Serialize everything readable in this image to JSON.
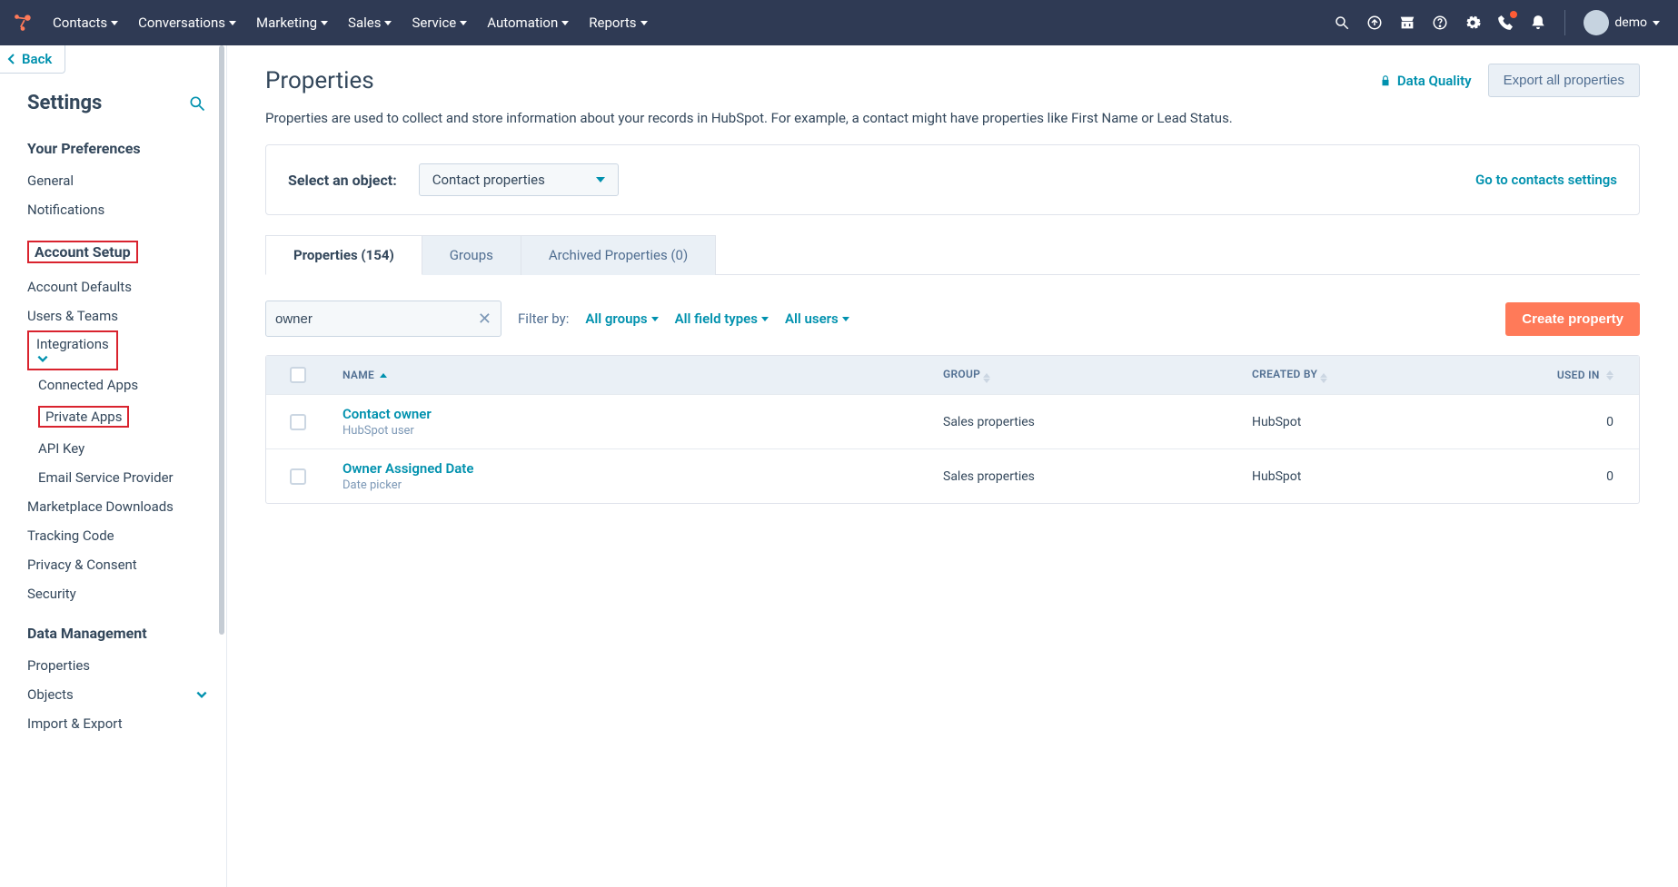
{
  "topnav": {
    "menu": [
      "Contacts",
      "Conversations",
      "Marketing",
      "Sales",
      "Service",
      "Automation",
      "Reports"
    ],
    "user_label": "demo"
  },
  "sidebar": {
    "back_label": "Back",
    "title": "Settings",
    "your_prefs": {
      "title": "Your Preferences",
      "items": [
        "General",
        "Notifications"
      ]
    },
    "account_setup": {
      "title": "Account Setup",
      "items": [
        "Account Defaults",
        "Users & Teams"
      ],
      "integrations_label": "Integrations",
      "integration_items": [
        "Connected Apps",
        "Private Apps",
        "API Key",
        "Email Service Provider"
      ],
      "trailing_items": [
        "Marketplace Downloads",
        "Tracking Code",
        "Privacy & Consent",
        "Security"
      ]
    },
    "data_mgmt": {
      "title": "Data Management",
      "items": [
        "Properties",
        "Objects",
        "Import & Export"
      ]
    }
  },
  "main": {
    "title": "Properties",
    "data_quality_label": "Data Quality",
    "export_label": "Export all properties",
    "subtext": "Properties are used to collect and store information about your records in HubSpot. For example, a contact might have properties like First Name or Lead Status.",
    "select_object_label": "Select an object:",
    "object_select_value": "Contact properties",
    "go_to_settings": "Go to contacts settings",
    "tabs": {
      "properties": "Properties (154)",
      "groups": "Groups",
      "archived": "Archived Properties (0)"
    },
    "search_value": "owner",
    "filter_by_label": "Filter by:",
    "filter_groups": "All groups",
    "filter_types": "All field types",
    "filter_users": "All users",
    "create_label": "Create property",
    "columns": {
      "name": "NAME",
      "group": "GROUP",
      "created_by": "CREATED BY",
      "used_in": "USED IN"
    },
    "rows": [
      {
        "name": "Contact owner",
        "type": "HubSpot user",
        "group": "Sales properties",
        "created_by": "HubSpot",
        "used_in": "0"
      },
      {
        "name": "Owner Assigned Date",
        "type": "Date picker",
        "group": "Sales properties",
        "created_by": "HubSpot",
        "used_in": "0"
      }
    ]
  }
}
